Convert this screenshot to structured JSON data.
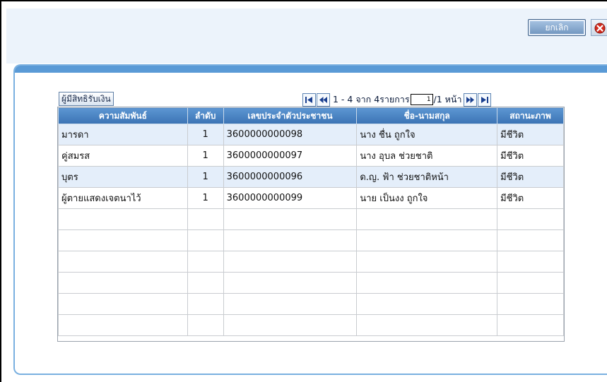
{
  "toolbar": {
    "cancel_label": "ยกเลิก"
  },
  "section": {
    "label": "ผู้มีสิทธิรับเงิน"
  },
  "pager": {
    "range_text": "1 - 4 จาก 4รายการ",
    "page_input_value": "1",
    "page_total_text": "/1 หน้า"
  },
  "table": {
    "headers": [
      "ความสัมพันธ์",
      "ลำดับ",
      "เลขประจำตัวประชาชน",
      "ชื่อ-นามสกุล",
      "สถานะภาพ"
    ],
    "rows": [
      [
        "มารดา",
        "1",
        "3600000000098",
        "นาง ชื่น ถูกใจ",
        "มีชีวิต"
      ],
      [
        "คู่สมรส",
        "1",
        "3600000000097",
        "นาง อุบล ช่วยชาติ",
        "มีชีวิต"
      ],
      [
        "บุตร",
        "1",
        "3600000000096",
        "ด.ญ. ฟ้า ช่วยชาติหน้า",
        "มีชีวิต"
      ],
      [
        "ผู้ตายแสดงเจตนาไว้",
        "1",
        "3600000000099",
        "นาย เป็นงง ถูกใจ",
        "มีชีวิต"
      ]
    ]
  },
  "colors": {
    "header_blue": "#3b73b4",
    "alt_row": "#e4eefa",
    "panel_border": "#7ab0e0"
  }
}
